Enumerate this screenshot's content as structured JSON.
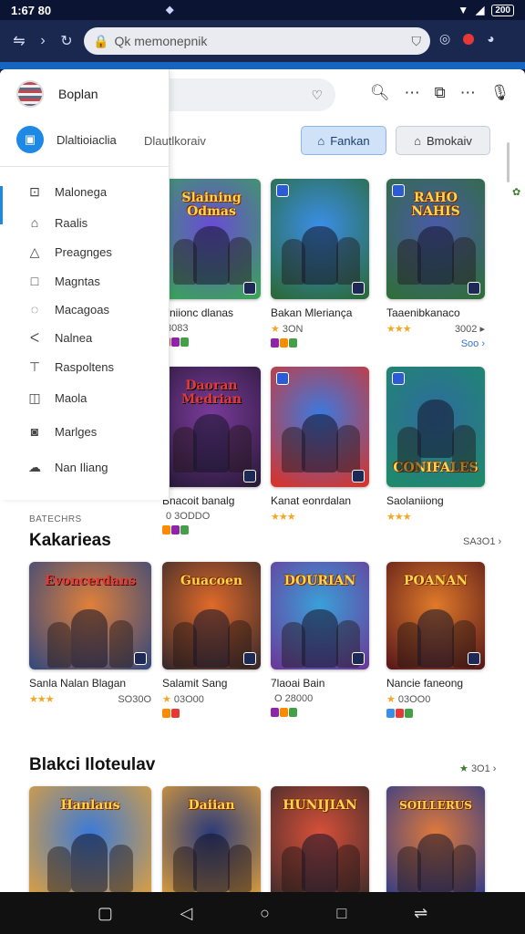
{
  "status_bar": {
    "time": "1:67 80",
    "battery": "200"
  },
  "browser": {
    "url": "Qk memonepnik"
  },
  "header": {
    "account_name": "Boplan",
    "search_placeholder": "",
    "primary_button": "Fankan",
    "secondary_button": "Bmokaiv"
  },
  "drawer": {
    "tab_label": "Dlaltioiaclia",
    "tab_label_2": "Dlautlkoraiv",
    "items": [
      {
        "label": "Malonega",
        "icon": "image-icon"
      },
      {
        "label": "Raalis",
        "icon": "home-icon"
      },
      {
        "label": "Preagnges",
        "icon": "warning-icon"
      },
      {
        "label": "Magntas",
        "icon": "square-icon"
      },
      {
        "label": "Macagoas",
        "icon": "chat-icon"
      },
      {
        "label": "Nalnea",
        "icon": "back-icon"
      },
      {
        "label": "Raspoltens",
        "icon": "pin-icon"
      },
      {
        "label": "Maola",
        "icon": "bookmark-icon"
      },
      {
        "label": "Marlges",
        "icon": "message-icon"
      },
      {
        "label": "Nan Iliang",
        "icon": "cloud-icon"
      }
    ]
  },
  "row1": [
    {
      "title": "Slaining Odmas",
      "name": "Bniionc dlanas",
      "meta": "3083",
      "stars": 0,
      "chips": true,
      "colors": [
        "#6a4bd6",
        "#3aa35a"
      ]
    },
    {
      "title": "",
      "name": "Bakan Mleriança",
      "meta": "3ON",
      "stars": 1,
      "chips": true,
      "colors": [
        "#3b8ee8",
        "#2a6a3a"
      ]
    },
    {
      "title": "RAHO NAHIS",
      "name": "Taaenibkanaco",
      "meta": "3002 ▸",
      "stars": 3,
      "chips": false,
      "colors": [
        "#4a5aa8",
        "#2f6e3a"
      ]
    }
  ],
  "row1_more": "Soo",
  "row2": [
    {
      "title": "Daoran Medrian",
      "name": "Bnacoit banalg",
      "meta": "0 3ODDO",
      "stars": 0,
      "chips": true,
      "colors": [
        "#7a3a9a",
        "#2a1a3a"
      ]
    },
    {
      "title": "",
      "name": "Kanat eonrdalan",
      "meta": "",
      "stars": 3,
      "chips": false,
      "colors": [
        "#3a7ae0",
        "#d7332c"
      ]
    },
    {
      "title": "CONIFALES",
      "name": "Saolaniiong",
      "meta": "",
      "stars": 3,
      "chips": false,
      "colors": [
        "#2e6b9e",
        "#1f8a6a"
      ]
    }
  ],
  "section2_small": "BATECHRS",
  "section2_title": "Kakarieas",
  "section2_see_all": "SA3O1",
  "row3": [
    {
      "title": "Evoncerdans",
      "name": "Sanla Nalan Blagan",
      "meta": "SO30O",
      "stars": 3,
      "chips": false,
      "colors": [
        "#e0803a",
        "#3a4a7a"
      ]
    },
    {
      "title": "Guacoen",
      "name": "Salamit Sang",
      "meta": "03O00",
      "stars": 1,
      "chips": true,
      "colors": [
        "#e06a2a",
        "#3a2a2a"
      ]
    },
    {
      "title": "DOURIAN",
      "name": "7laoai Bain",
      "meta": "O 28000",
      "stars": 0,
      "chips": true,
      "colors": [
        "#3aa0d8",
        "#6a3a9a"
      ]
    },
    {
      "title": "POANAN",
      "name": "Nancie faneong",
      "meta": "03OO0",
      "stars": 1,
      "chips": true,
      "colors": [
        "#e07a2a",
        "#5a1a1a"
      ]
    }
  ],
  "section3_title": "Blakci Iloteulav",
  "section3_see_all": "3O1",
  "row4": [
    {
      "title": "Hanlaus",
      "colors": [
        "#3a7ad8",
        "#e0a03a"
      ]
    },
    {
      "title": "Daiian",
      "colors": [
        "#2a3a7a",
        "#e0a03a"
      ]
    },
    {
      "title": "HUNIJIAN",
      "colors": [
        "#d8503a",
        "#3a2a2a"
      ]
    },
    {
      "title": "SOILLERUS",
      "colors": [
        "#e07a3a",
        "#2a3a8a"
      ]
    }
  ]
}
